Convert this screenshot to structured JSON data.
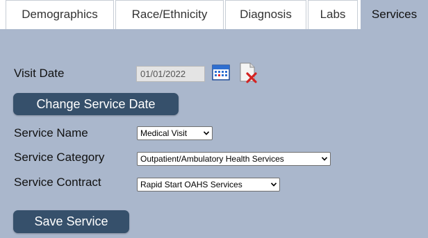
{
  "tabs": [
    {
      "label": "Demographics",
      "active": false
    },
    {
      "label": "Race/Ethnicity",
      "active": false
    },
    {
      "label": "Diagnosis",
      "active": false
    },
    {
      "label": "Labs",
      "active": false
    },
    {
      "label": "Services",
      "active": true
    }
  ],
  "form": {
    "visit_date_label": "Visit Date",
    "visit_date_value": "01/01/2022",
    "change_date_button": "Change Service Date",
    "service_name_label": "Service Name",
    "service_name_value": "Medical Visit",
    "service_category_label": "Service Category",
    "service_category_value": "Outpatient/Ambulatory Health Services",
    "service_contract_label": "Service Contract",
    "service_contract_value": "Rapid Start OAHS Services",
    "save_button": "Save Service"
  },
  "colors": {
    "panel_bg": "#aab7cc",
    "button_bg": "#36506b",
    "tab_border": "#c7cdd5"
  },
  "icons": {
    "calendar": "calendar-icon",
    "clear": "clear-date-icon"
  }
}
